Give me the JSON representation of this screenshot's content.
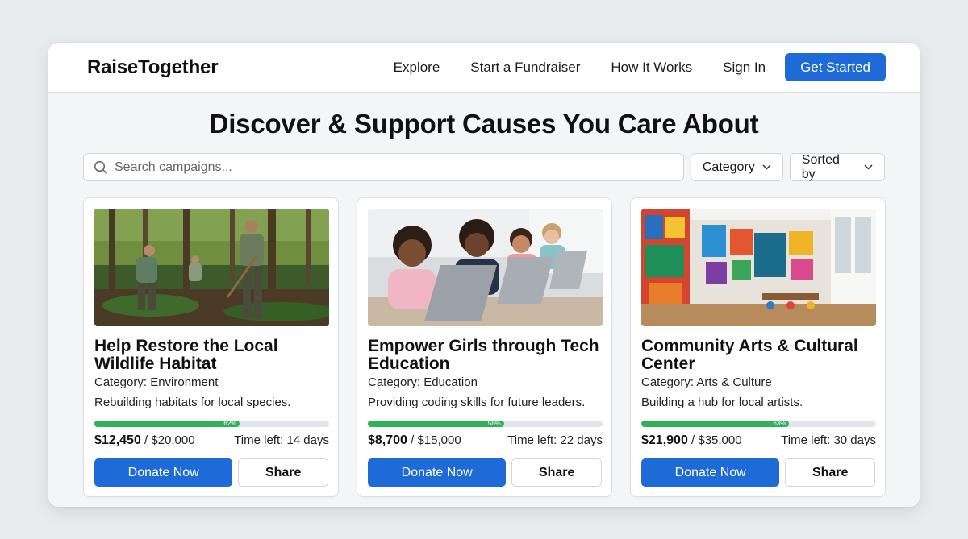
{
  "header": {
    "brand": "RaiseTogether",
    "nav": [
      "Explore",
      "Start a Fundraiser",
      "How It Works",
      "Sign In"
    ],
    "cta": "Get Started"
  },
  "main": {
    "headline": "Discover & Support Causes You Care About",
    "search": {
      "placeholder": "Search campaigns...",
      "icon": "search-icon"
    },
    "filters": {
      "category": "Category",
      "sort": "Sorted by"
    }
  },
  "colors": {
    "primary": "#1e6ad6",
    "progress": "#2fb15a",
    "track": "#e3e6e9"
  },
  "campaigns": [
    {
      "image": "volunteers planting trees in forest",
      "title": "Help Restore the Local Wildlife Habitat",
      "category": "Category: Environment",
      "description": "Rebuilding habitats for local species.",
      "progress": 0.62,
      "progress_label": "62%",
      "raised": "$12,450",
      "goal": " / $20,000",
      "time_left": "Time left: 14 days",
      "donate": "Donate Now",
      "share": "Share"
    },
    {
      "image": "girls coding on laptops in classroom",
      "title": "Empower Girls through Tech Education",
      "category": "Category: Education",
      "description": "Providing coding skills for future leaders.",
      "progress": 0.58,
      "progress_label": "58%",
      "raised": "$8,700",
      "goal": " / $15,000",
      "time_left": "Time left: 22 days",
      "donate": "Donate Now",
      "share": "Share"
    },
    {
      "image": "colorful art studio interior",
      "title": "Community Arts & Cultural Center",
      "category": "Category: Arts & Culture",
      "description": "Building a hub for local artists.",
      "progress": 0.63,
      "progress_label": "63%",
      "raised": "$21,900",
      "goal": " / $35,000",
      "time_left": "Time left: 30 days",
      "donate": "Donate Now",
      "share": "Share"
    }
  ]
}
